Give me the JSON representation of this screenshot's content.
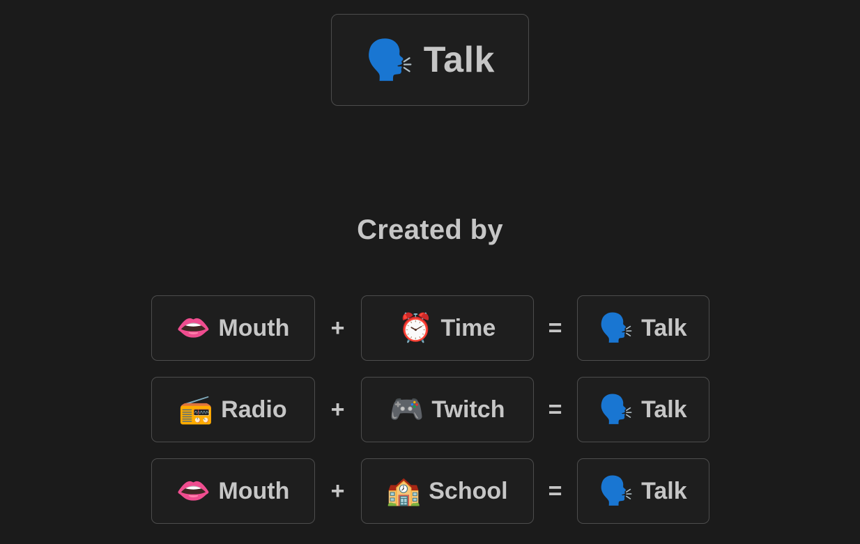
{
  "page": {
    "background_color": "#1b1b1b",
    "card_background_color": "#1e1e1e",
    "card_border_color": "#4d4d4d",
    "text_color": "#c6c6c6"
  },
  "result_card": {
    "icon": "speaking-head-emoji",
    "emoji": "🗣️",
    "label": "Talk"
  },
  "created_by": {
    "heading": "Created by"
  },
  "operators": {
    "plus": "+",
    "equals": "="
  },
  "recipes": [
    {
      "a": {
        "emoji": "👄",
        "icon": "mouth-emoji",
        "label": "Mouth"
      },
      "b": {
        "emoji": "⏰",
        "icon": "alarm-clock-emoji",
        "label": "Time"
      },
      "result": {
        "emoji": "🗣️",
        "icon": "speaking-head-emoji",
        "label": "Talk"
      }
    },
    {
      "a": {
        "emoji": "📻",
        "icon": "radio-emoji",
        "label": "Radio"
      },
      "b": {
        "emoji": "🎮",
        "icon": "video-game-controller-emoji",
        "label": "Twitch"
      },
      "result": {
        "emoji": "🗣️",
        "icon": "speaking-head-emoji",
        "label": "Talk"
      }
    },
    {
      "a": {
        "emoji": "👄",
        "icon": "mouth-emoji",
        "label": "Mouth"
      },
      "b": {
        "emoji": "🏫",
        "icon": "school-emoji",
        "label": "School"
      },
      "result": {
        "emoji": "🗣️",
        "icon": "speaking-head-emoji",
        "label": "Talk"
      }
    }
  ]
}
